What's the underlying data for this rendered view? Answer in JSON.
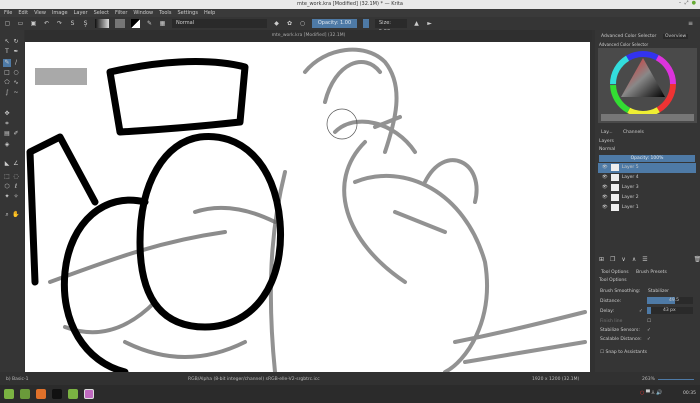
{
  "window": {
    "title": "mte_work.kra [Modified]  (32.1M) * — Krita"
  },
  "menu": [
    "File",
    "Edit",
    "View",
    "Image",
    "Layer",
    "Select",
    "Filter",
    "Window",
    "Tools",
    "Settings",
    "Help"
  ],
  "toolbar": {
    "blend_mode": "Normal",
    "opacity": "Opacity: 1.00",
    "size": "Size: 5.00 px"
  },
  "canvas_tab": "mte_work.kra [Modified]  (32.1M)",
  "dock": {
    "tabs": [
      "Advanced Color Selector",
      "Overview"
    ],
    "color_selector_title": "Advanced Color Selector",
    "layer_tabs": [
      "Lay...",
      "Channels"
    ],
    "layers_title": "Layers",
    "layer_blend": "Normal",
    "layer_opacity": "Opacity: 100%",
    "layers": [
      {
        "name": "Layer 5",
        "selected": true
      },
      {
        "name": "Layer 4"
      },
      {
        "name": "Layer 3"
      },
      {
        "name": "Layer 2"
      },
      {
        "name": "Layer 1"
      }
    ],
    "option_tabs": [
      "Tool Options",
      "Brush Presets"
    ],
    "tool_options_title": "Tool Options",
    "options": {
      "brush_smoothing_label": "Brush Smoothing:",
      "brush_smoothing": "Stabilizer",
      "distance_label": "Distance:",
      "distance": "49.5",
      "delay_label": "Delay:",
      "delay": "43 px",
      "finish_line": "Finish line",
      "stabilize_sensors": "Stabilize Sensors:",
      "scalable_distance": "Scalable Distance:",
      "snap": "Snap to Assistants"
    }
  },
  "status": {
    "brush": "b) Basic-1",
    "color_space": "RGB/Alpha (8-bit integer/channel)  sRGB-elle-V2-srgbtrc.icc",
    "dimensions": "1920 x 1200 (32.1M)",
    "zoom": "263%"
  },
  "taskbar": {
    "clock": "00:35"
  },
  "colors": {
    "accent": "#4e7aa6",
    "canvas": "#ffffff",
    "panel": "#353535"
  }
}
